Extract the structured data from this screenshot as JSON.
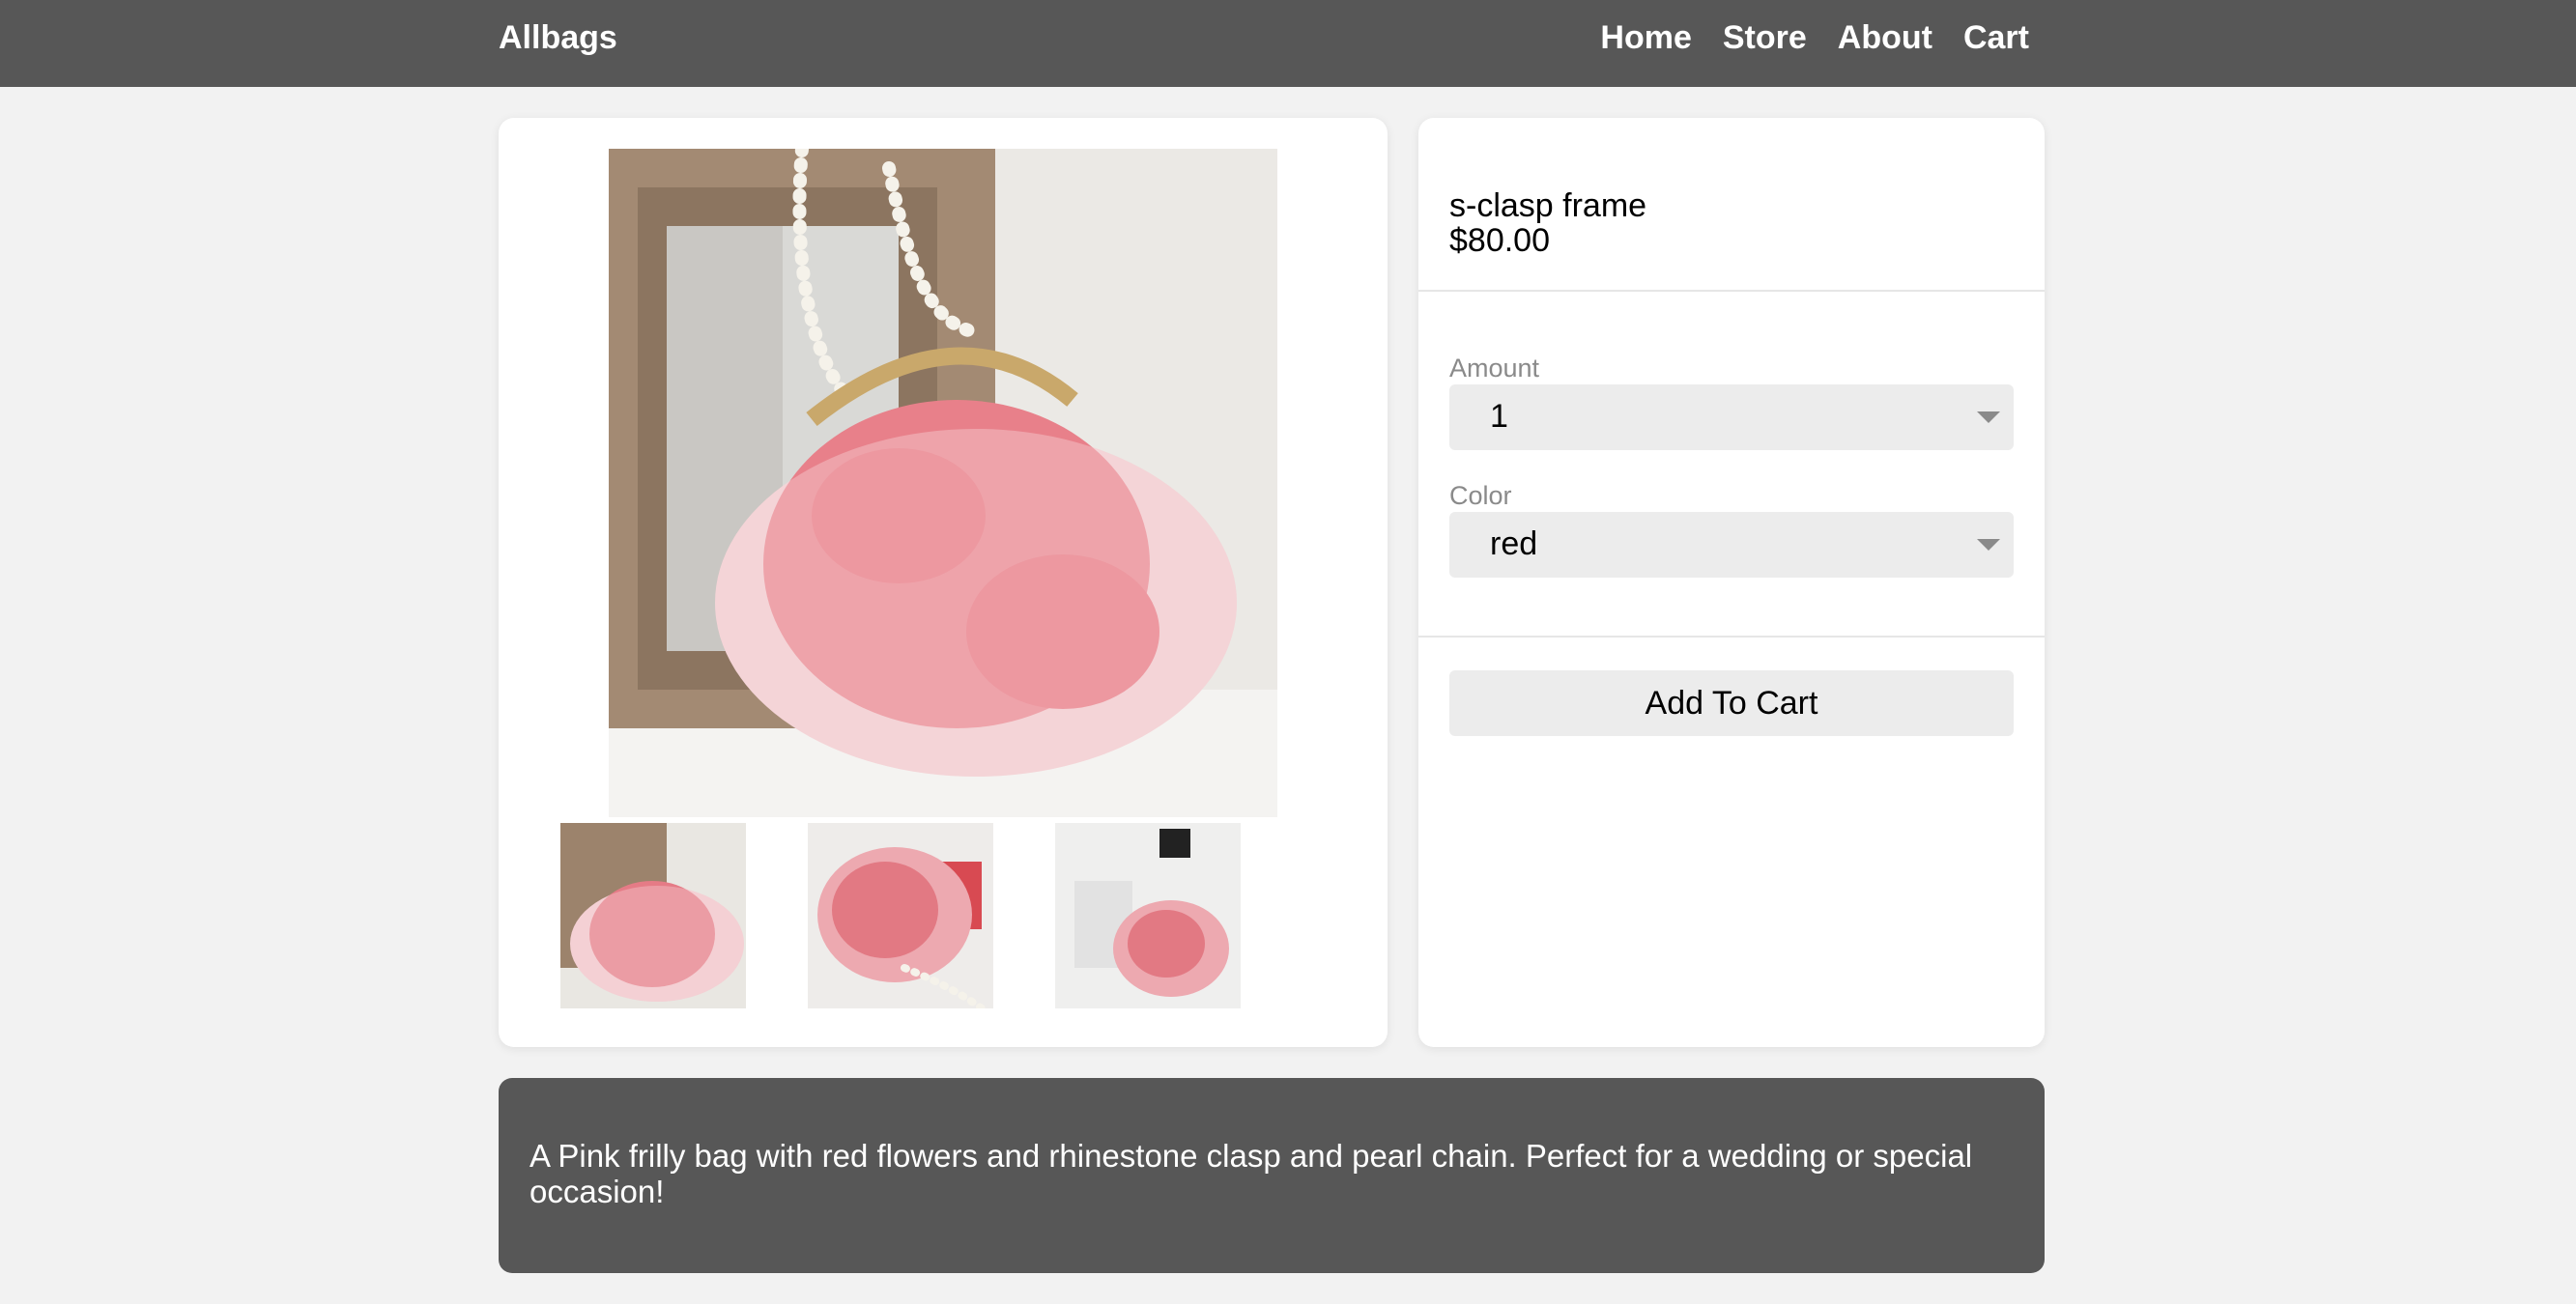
{
  "header": {
    "brand": "Allbags",
    "nav": [
      "Home",
      "Store",
      "About",
      "Cart"
    ]
  },
  "product": {
    "name": "s-clasp frame",
    "price": "$80.00",
    "amount_label": "Amount",
    "amount_value": "1",
    "color_label": "Color",
    "color_value": "red",
    "add_to_cart": "Add To Cart",
    "description": "A Pink frilly bag with red flowers and rhinestone clasp and pearl chain. Perfect for a wedding or special occasion!"
  },
  "colors": {
    "header_bg": "#575757",
    "page_bg": "#f2f2f2",
    "control_bg": "#ececec",
    "bag_pink": "#e8707a"
  }
}
